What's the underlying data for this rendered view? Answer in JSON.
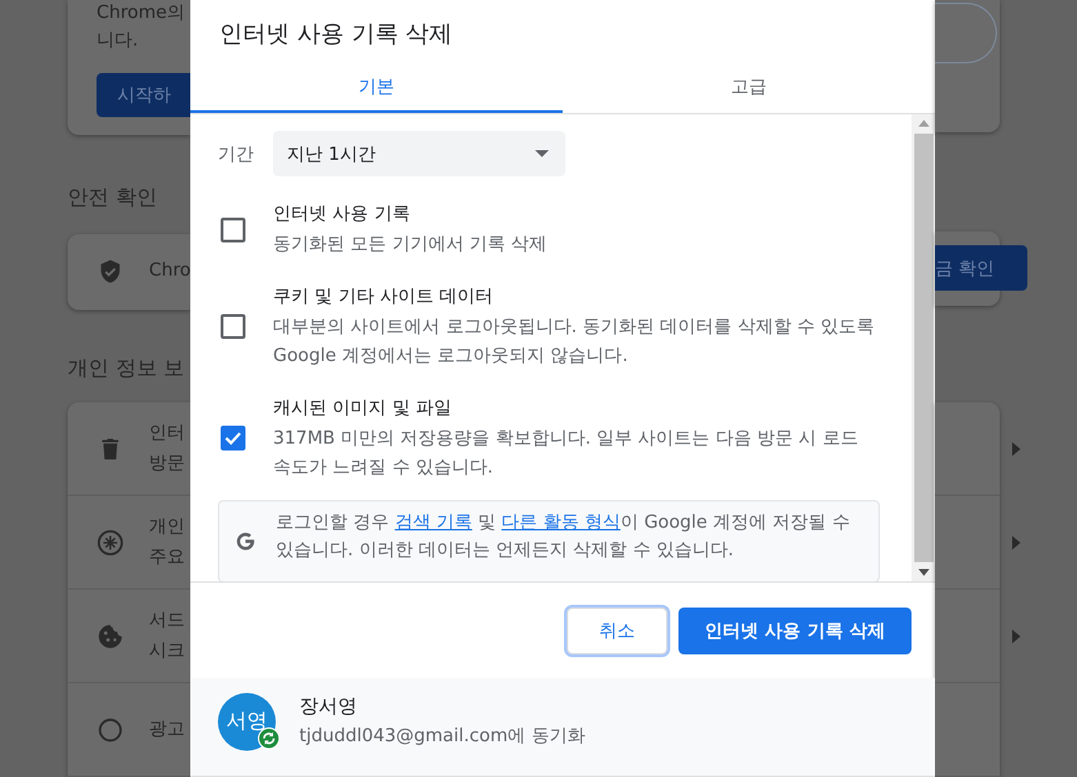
{
  "background_page": {
    "intro_card": {
      "lines": [
        "Chrome의",
        "니다."
      ],
      "button": "시작하"
    },
    "safety_check": {
      "heading": "안전 확인",
      "text": "Chro",
      "button": "금 확인"
    },
    "privacy": {
      "heading": "개인 정보 보",
      "rows": [
        {
          "title": "인터",
          "subtitle": "방문"
        },
        {
          "title": "개인",
          "subtitle": "주요"
        },
        {
          "title": "서드",
          "subtitle": "시크"
        },
        {
          "title": "광고"
        }
      ]
    }
  },
  "dialog": {
    "title": "인터넷 사용 기록 삭제",
    "tabs": [
      {
        "label": "기본",
        "selected": true
      },
      {
        "label": "고급",
        "selected": false
      }
    ],
    "time_range": {
      "label": "기간",
      "value": "지난 1시간"
    },
    "options": [
      {
        "title": "인터넷 사용 기록",
        "description": "동기화된 모든 기기에서 기록 삭제",
        "checked": false
      },
      {
        "title": "쿠키 및 기타 사이트 데이터",
        "description": "대부분의 사이트에서 로그아웃됩니다. 동기화된 데이터를 삭제할 수 있도록 Google 계정에서는 로그아웃되지 않습니다.",
        "checked": false
      },
      {
        "title": "캐시된 이미지 및 파일",
        "description": "317MB 미만의 저장용량을 확보합니다. 일부 사이트는 다음 방문 시 로드 속도가 느려질 수 있습니다.",
        "checked": true
      }
    ],
    "notice": {
      "parts": [
        {
          "kind": "text",
          "text": "로그인할 경우 "
        },
        {
          "kind": "link",
          "text": "검색 기록"
        },
        {
          "kind": "text",
          "text": " 및 "
        },
        {
          "kind": "link",
          "text": "다른 활동 형식"
        },
        {
          "kind": "text",
          "text": "이 Google 계정에 저장될 수 있습니다. 이러한 데이터는 언제든지 삭제할 수 있습니다."
        }
      ]
    },
    "buttons": [
      {
        "label": "취소",
        "kind": "secondary"
      },
      {
        "label": "인터넷 사용 기록 삭제",
        "kind": "primary"
      }
    ],
    "account": {
      "initials": "서영",
      "name": "장서영",
      "sync_text": "tjduddl043@gmail.com에 동기화"
    }
  }
}
